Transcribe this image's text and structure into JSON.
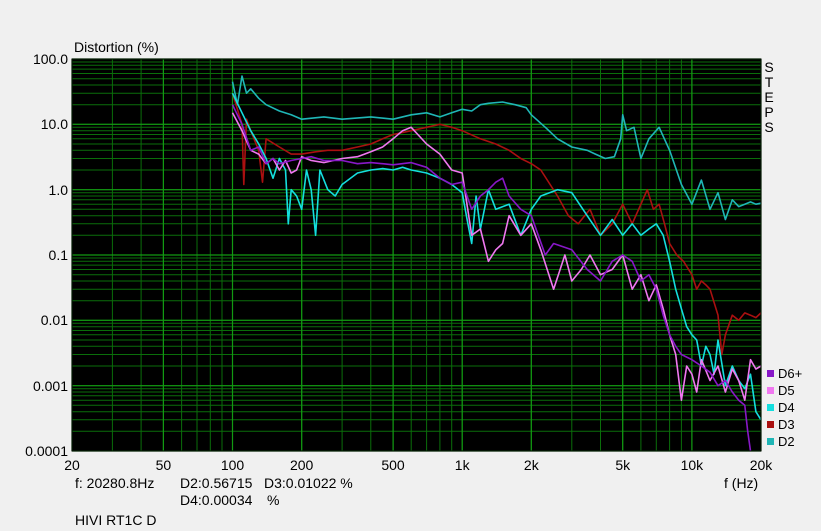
{
  "header": {
    "ylabel": "Distortion (%)",
    "side_label": "STEPS"
  },
  "footer": {
    "freq": "f: 20280.8Hz",
    "d2": "D2:0.56715",
    "d3": "D3:0.01022 %",
    "d4": "D4:0.00034",
    "d4_unit": "%",
    "xlabel": "f (Hz)",
    "device": "HIVI RT1C D"
  },
  "colors": {
    "background": "#000000",
    "grid": "#0a6e0a",
    "frame": "#f0f0f0"
  },
  "chart_data": {
    "type": "line",
    "title": "",
    "ylabel": "Distortion (%)",
    "xlabel": "f (Hz)",
    "xscale": "log",
    "yscale": "log",
    "xlim": [
      20,
      20000
    ],
    "ylim": [
      0.0001,
      100
    ],
    "grid": true,
    "legend_position": "bottom-right",
    "x_tick_labels": [
      "20",
      "50",
      "100",
      "200",
      "500",
      "1k",
      "2k",
      "5k",
      "10k",
      "20k"
    ],
    "x_ticks": [
      20,
      50,
      100,
      200,
      500,
      1000,
      2000,
      5000,
      10000,
      20000
    ],
    "y_tick_labels": [
      "100.0",
      "10.0",
      "1.0",
      "0.1",
      "0.01",
      "0.001",
      "0.0001"
    ],
    "y_ticks": [
      100,
      10,
      1,
      0.1,
      0.01,
      0.001,
      0.0001
    ],
    "series": [
      {
        "name": "D2",
        "color": "#1fb6b6",
        "points": [
          [
            100,
            45
          ],
          [
            105,
            20
          ],
          [
            110,
            55
          ],
          [
            115,
            30
          ],
          [
            120,
            35
          ],
          [
            130,
            25
          ],
          [
            140,
            20
          ],
          [
            160,
            16
          ],
          [
            180,
            14
          ],
          [
            200,
            12
          ],
          [
            250,
            13
          ],
          [
            300,
            12
          ],
          [
            400,
            13
          ],
          [
            500,
            12
          ],
          [
            600,
            14
          ],
          [
            700,
            15
          ],
          [
            800,
            13
          ],
          [
            900,
            15
          ],
          [
            1000,
            17
          ],
          [
            1100,
            16
          ],
          [
            1200,
            20
          ],
          [
            1300,
            21
          ],
          [
            1500,
            22
          ],
          [
            1700,
            20
          ],
          [
            1900,
            18
          ],
          [
            2000,
            14
          ],
          [
            2300,
            9
          ],
          [
            2600,
            6
          ],
          [
            3000,
            4.5
          ],
          [
            3500,
            4
          ],
          [
            3800,
            3.5
          ],
          [
            4200,
            3
          ],
          [
            4600,
            3.2
          ],
          [
            4900,
            6
          ],
          [
            5000,
            14
          ],
          [
            5200,
            8
          ],
          [
            5600,
            9
          ],
          [
            6000,
            3
          ],
          [
            6500,
            6
          ],
          [
            7200,
            9
          ],
          [
            8000,
            4
          ],
          [
            9000,
            1.2
          ],
          [
            10000,
            0.6
          ],
          [
            11000,
            1.4
          ],
          [
            12000,
            0.5
          ],
          [
            13000,
            0.9
          ],
          [
            14000,
            0.35
          ],
          [
            15000,
            0.7
          ],
          [
            16000,
            0.55
          ],
          [
            17000,
            0.6
          ],
          [
            18000,
            0.65
          ],
          [
            19000,
            0.6
          ],
          [
            20000,
            0.62
          ]
        ]
      },
      {
        "name": "D3",
        "color": "#aa1010",
        "points": [
          [
            100,
            30
          ],
          [
            110,
            10
          ],
          [
            112,
            1.2
          ],
          [
            115,
            12
          ],
          [
            120,
            8
          ],
          [
            130,
            4
          ],
          [
            135,
            1.3
          ],
          [
            140,
            6
          ],
          [
            160,
            4.5
          ],
          [
            180,
            3.5
          ],
          [
            200,
            3.5
          ],
          [
            230,
            3.8
          ],
          [
            260,
            4
          ],
          [
            300,
            4
          ],
          [
            350,
            4.5
          ],
          [
            400,
            5
          ],
          [
            450,
            6
          ],
          [
            500,
            7
          ],
          [
            600,
            8
          ],
          [
            700,
            9
          ],
          [
            800,
            10
          ],
          [
            900,
            9
          ],
          [
            1000,
            8
          ],
          [
            1200,
            6
          ],
          [
            1400,
            5
          ],
          [
            1600,
            4
          ],
          [
            1800,
            3
          ],
          [
            2000,
            2.5
          ],
          [
            2200,
            2
          ],
          [
            2600,
            0.8
          ],
          [
            2900,
            0.4
          ],
          [
            3200,
            0.3
          ],
          [
            3600,
            0.5
          ],
          [
            4000,
            0.2
          ],
          [
            4500,
            0.3
          ],
          [
            5000,
            0.6
          ],
          [
            5500,
            0.3
          ],
          [
            6000,
            0.6
          ],
          [
            6400,
            1
          ],
          [
            6800,
            0.5
          ],
          [
            7200,
            0.6
          ],
          [
            7600,
            0.3
          ],
          [
            8000,
            0.15
          ],
          [
            8600,
            0.1
          ],
          [
            9200,
            0.08
          ],
          [
            10000,
            0.05
          ],
          [
            10500,
            0.03
          ],
          [
            11000,
            0.04
          ],
          [
            11500,
            0.035
          ],
          [
            12000,
            0.03
          ],
          [
            13000,
            0.012
          ],
          [
            13500,
            0.003
          ],
          [
            14000,
            0.006
          ],
          [
            15000,
            0.012
          ],
          [
            16000,
            0.01
          ],
          [
            17000,
            0.013
          ],
          [
            18000,
            0.012
          ],
          [
            19000,
            0.011
          ],
          [
            20000,
            0.013
          ]
        ]
      },
      {
        "name": "D4",
        "color": "#14dede",
        "points": [
          [
            100,
            30
          ],
          [
            110,
            15
          ],
          [
            120,
            8
          ],
          [
            130,
            5
          ],
          [
            140,
            3
          ],
          [
            150,
            1.5
          ],
          [
            160,
            3
          ],
          [
            170,
            2
          ],
          [
            175,
            0.3
          ],
          [
            180,
            1
          ],
          [
            190,
            0.8
          ],
          [
            200,
            0.5
          ],
          [
            210,
            2
          ],
          [
            220,
            1
          ],
          [
            230,
            0.2
          ],
          [
            240,
            2
          ],
          [
            260,
            1
          ],
          [
            280,
            0.8
          ],
          [
            300,
            1.2
          ],
          [
            350,
            1.8
          ],
          [
            400,
            2
          ],
          [
            450,
            2.1
          ],
          [
            500,
            2
          ],
          [
            550,
            2.2
          ],
          [
            600,
            2
          ],
          [
            700,
            1.8
          ],
          [
            800,
            1.5
          ],
          [
            900,
            1.2
          ],
          [
            1000,
            0.9
          ],
          [
            1050,
            0.35
          ],
          [
            1100,
            0.15
          ],
          [
            1150,
            0.8
          ],
          [
            1200,
            0.25
          ],
          [
            1300,
            1
          ],
          [
            1400,
            0.5
          ],
          [
            1600,
            0.6
          ],
          [
            1800,
            0.2
          ],
          [
            2000,
            0.5
          ],
          [
            2200,
            0.8
          ],
          [
            2600,
            1
          ],
          [
            3000,
            0.9
          ],
          [
            3500,
            0.4
          ],
          [
            4000,
            0.2
          ],
          [
            4500,
            0.35
          ],
          [
            5000,
            0.2
          ],
          [
            5500,
            0.3
          ],
          [
            6000,
            0.2
          ],
          [
            6500,
            0.25
          ],
          [
            7000,
            0.3
          ],
          [
            7500,
            0.2
          ],
          [
            8000,
            0.08
          ],
          [
            8500,
            0.03
          ],
          [
            9000,
            0.015
          ],
          [
            9500,
            0.008
          ],
          [
            10000,
            0.006
          ],
          [
            10500,
            0.005
          ],
          [
            11000,
            0.002
          ],
          [
            11500,
            0.004
          ],
          [
            12000,
            0.003
          ],
          [
            12500,
            0.0015
          ],
          [
            13000,
            0.005
          ],
          [
            14000,
            0.001
          ],
          [
            15000,
            0.002
          ],
          [
            16000,
            0.0012
          ],
          [
            17000,
            0.0009
          ],
          [
            18000,
            0.0015
          ],
          [
            19000,
            0.0004
          ],
          [
            20000,
            0.0003
          ]
        ]
      },
      {
        "name": "D5",
        "color": "#f078f0",
        "points": [
          [
            100,
            15
          ],
          [
            110,
            8
          ],
          [
            120,
            4
          ],
          [
            130,
            3.5
          ],
          [
            140,
            2.5
          ],
          [
            150,
            3
          ],
          [
            160,
            2
          ],
          [
            170,
            2.8
          ],
          [
            180,
            1.8
          ],
          [
            190,
            2
          ],
          [
            200,
            3.2
          ],
          [
            220,
            2.8
          ],
          [
            250,
            2.6
          ],
          [
            300,
            3
          ],
          [
            350,
            3.2
          ],
          [
            400,
            3.8
          ],
          [
            450,
            4.5
          ],
          [
            500,
            6
          ],
          [
            550,
            8
          ],
          [
            600,
            9
          ],
          [
            700,
            5
          ],
          [
            800,
            3.5
          ],
          [
            900,
            2
          ],
          [
            1000,
            1.8
          ],
          [
            1100,
            0.2
          ],
          [
            1200,
            0.25
          ],
          [
            1300,
            0.08
          ],
          [
            1400,
            0.12
          ],
          [
            1500,
            0.15
          ],
          [
            1600,
            0.4
          ],
          [
            1800,
            0.2
          ],
          [
            2000,
            0.3
          ],
          [
            2200,
            0.12
          ],
          [
            2500,
            0.03
          ],
          [
            2800,
            0.1
          ],
          [
            3000,
            0.04
          ],
          [
            3300,
            0.06
          ],
          [
            3600,
            0.1
          ],
          [
            4000,
            0.05
          ],
          [
            4500,
            0.06
          ],
          [
            5000,
            0.1
          ],
          [
            5500,
            0.03
          ],
          [
            6000,
            0.05
          ],
          [
            6500,
            0.02
          ],
          [
            7000,
            0.035
          ],
          [
            7500,
            0.015
          ],
          [
            8000,
            0.006
          ],
          [
            8500,
            0.003
          ],
          [
            9000,
            0.0006
          ],
          [
            9500,
            0.002
          ],
          [
            10000,
            0.0015
          ],
          [
            10500,
            0.0008
          ],
          [
            11000,
            0.0025
          ],
          [
            12000,
            0.0012
          ],
          [
            13000,
            0.002
          ],
          [
            14000,
            0.0008
          ],
          [
            15000,
            0.0018
          ],
          [
            16000,
            0.0012
          ],
          [
            17000,
            0.0006
          ],
          [
            18000,
            0.0025
          ],
          [
            19000,
            0.0018
          ],
          [
            20000,
            0.002
          ]
        ]
      },
      {
        "name": "D6+",
        "color": "#8818c8",
        "points": [
          [
            100,
            20
          ],
          [
            110,
            10
          ],
          [
            120,
            4
          ],
          [
            130,
            4.5
          ],
          [
            140,
            2.5
          ],
          [
            150,
            3
          ],
          [
            160,
            2.5
          ],
          [
            180,
            2.8
          ],
          [
            200,
            3
          ],
          [
            220,
            3.2
          ],
          [
            250,
            2.8
          ],
          [
            300,
            2.8
          ],
          [
            350,
            2.5
          ],
          [
            400,
            2.6
          ],
          [
            450,
            2.5
          ],
          [
            500,
            2.4
          ],
          [
            600,
            2.6
          ],
          [
            700,
            2.2
          ],
          [
            800,
            1.5
          ],
          [
            900,
            1.2
          ],
          [
            1000,
            1.3
          ],
          [
            1100,
            0.5
          ],
          [
            1200,
            0.8
          ],
          [
            1300,
            1
          ],
          [
            1400,
            1.3
          ],
          [
            1500,
            1.5
          ],
          [
            1600,
            0.8
          ],
          [
            1800,
            0.5
          ],
          [
            2000,
            0.4
          ],
          [
            2300,
            0.1
          ],
          [
            2500,
            0.15
          ],
          [
            3000,
            0.12
          ],
          [
            3500,
            0.06
          ],
          [
            4000,
            0.04
          ],
          [
            4500,
            0.08
          ],
          [
            5000,
            0.1
          ],
          [
            5500,
            0.08
          ],
          [
            6000,
            0.04
          ],
          [
            6500,
            0.05
          ],
          [
            7000,
            0.03
          ],
          [
            7500,
            0.012
          ],
          [
            8000,
            0.006
          ],
          [
            8500,
            0.004
          ],
          [
            9000,
            0.003
          ],
          [
            10000,
            0.0025
          ],
          [
            11000,
            0.002
          ],
          [
            12000,
            0.0016
          ],
          [
            13000,
            0.001
          ],
          [
            14000,
            0.0012
          ],
          [
            15000,
            0.0008
          ],
          [
            16000,
            0.0006
          ],
          [
            17000,
            0.0005
          ],
          [
            17500,
            0.0002
          ],
          [
            18000,
            0.0001
          ]
        ]
      }
    ],
    "legend_order": [
      "D6+",
      "D5",
      "D4",
      "D3",
      "D2"
    ]
  }
}
